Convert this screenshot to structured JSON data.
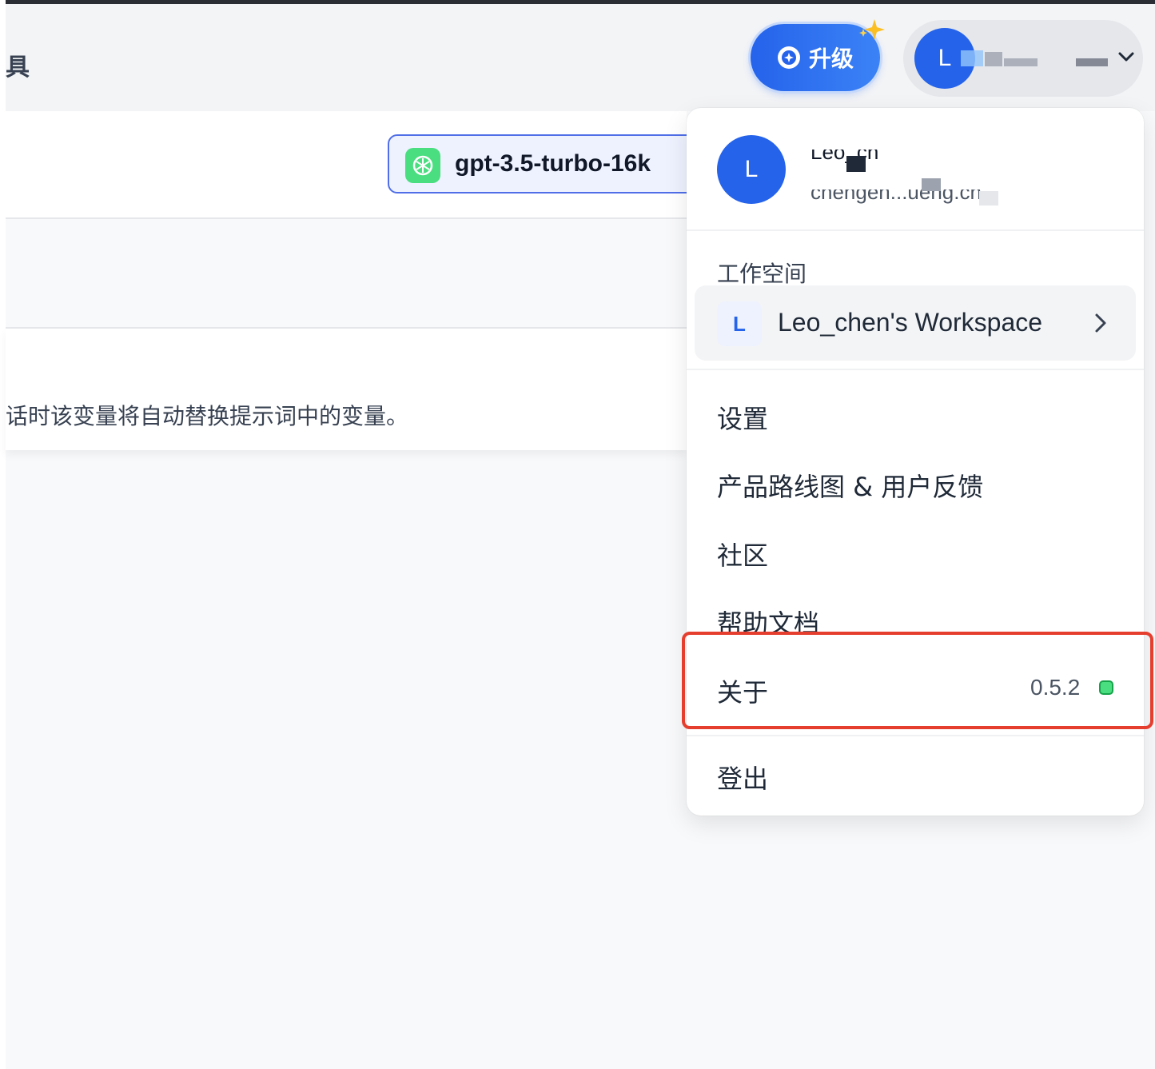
{
  "header": {
    "truncated_title": "具",
    "upgrade_label": "升级",
    "account_initial": "L"
  },
  "model": {
    "name": "gpt-3.5-turbo-16k"
  },
  "prompt_hint": "话时该变量将自动替换提示词中的变量。",
  "menu": {
    "avatar_initial": "L",
    "user_name": "Leo_ch",
    "user_email": "chengen...ueng.cn",
    "workspace_section_label": "工作空间",
    "workspace": {
      "initial": "L",
      "name": "Leo_chen's Workspace"
    },
    "items": [
      {
        "label": "设置"
      },
      {
        "label": "产品路线图 & 用户反馈"
      },
      {
        "label": "社区"
      },
      {
        "label": "帮助文档"
      },
      {
        "label": "关于"
      },
      {
        "label": "登出"
      }
    ],
    "version": "0.5.2",
    "status_color": "#4ade80"
  },
  "colors": {
    "accent": "#2563eb",
    "highlight": "#e53e2e"
  }
}
